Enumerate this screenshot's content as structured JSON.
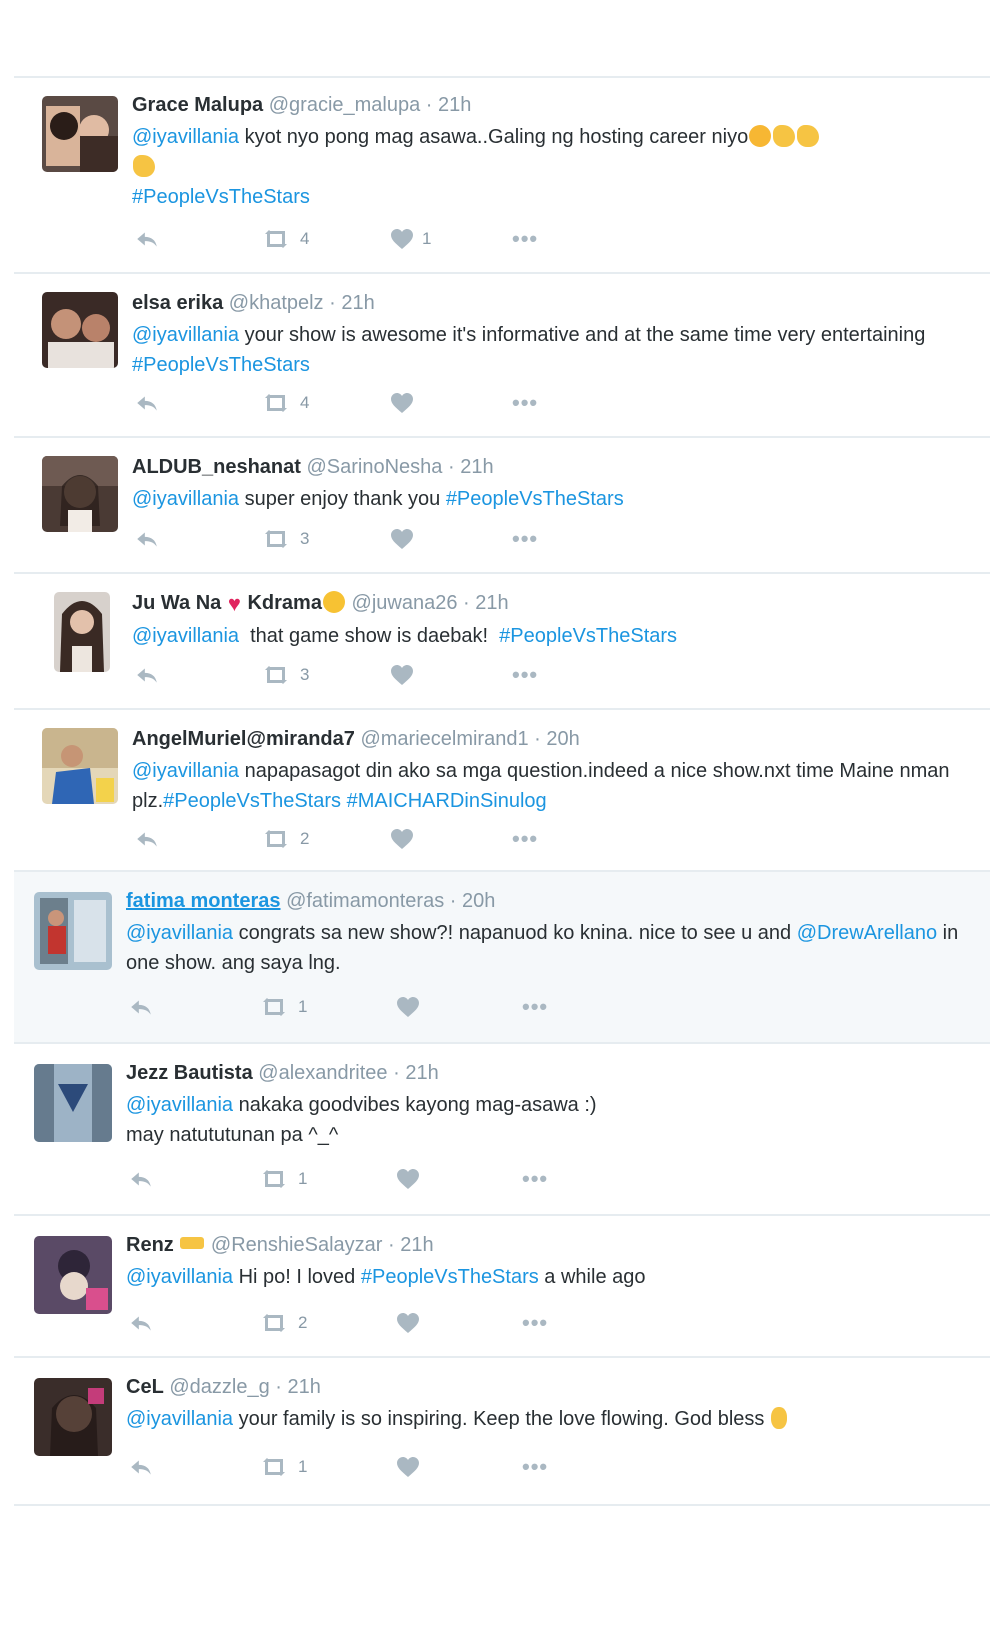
{
  "colors": {
    "link": "#1b95e0",
    "muted": "#8899a6",
    "icon": "#aab8c2",
    "divider": "#e6ecf0",
    "highlight_bg": "#f5f8fa"
  },
  "icons": {
    "reply": "reply-icon",
    "retweet": "retweet-icon",
    "like": "heart-icon",
    "more": "more-icon"
  },
  "tweets": [
    {
      "name": "Grace Malupa",
      "handle": "@gracie_malupa",
      "time": "21h",
      "mention": "@iyavillania",
      "t1": " kyot nyo pong mag asawa..Galing ng hosting career niyo",
      "hashtag": "#PeopleVsTheStars",
      "retweets": "4",
      "likes": "1"
    },
    {
      "name": "elsa erika",
      "handle": "@khatpelz",
      "time": "21h",
      "mention": "@iyavillania",
      "t1": " your show is awesome it's informative and at the same time very entertaining ",
      "hashtag": "#PeopleVsTheStars",
      "retweets": "4",
      "likes": ""
    },
    {
      "name": "ALDUB_neshanat",
      "handle": "@SarinoNesha",
      "time": "21h",
      "mention": "@iyavillania",
      "t1": " super enjoy thank you ",
      "hashtag": "#PeopleVsTheStars",
      "retweets": "3",
      "likes": ""
    },
    {
      "name_a": "Ju Wa Na",
      "name_b": "Kdrama",
      "handle": "@juwana26",
      "time": "21h",
      "mention": "@iyavillania",
      "t1": "  that game show is daebak!  ",
      "hashtag": "#PeopleVsTheStars",
      "retweets": "3",
      "likes": ""
    },
    {
      "name": "AngelMuriel@miranda7",
      "handle": "@mariecelmirand1",
      "time": "20h",
      "mention": "@iyavillania",
      "t1": " napapasagot din ako sa mga question.indeed a nice show.nxt time Maine nman plz.",
      "hashtag": "#PeopleVsTheStars",
      "hashtag2": "#MAICHARDinSinulog",
      "retweets": "2",
      "likes": ""
    },
    {
      "name": "fatima monteras",
      "handle": "@fatimamonteras",
      "time": "20h",
      "mention": "@iyavillania",
      "t1": " congrats sa new show?! napanuod ko knina. nice to see u and ",
      "mention2": "@DrewArellano",
      "t2": " in one show. ang saya lng.",
      "retweets": "1",
      "likes": ""
    },
    {
      "name": "Jezz Bautista",
      "handle": "@alexandritee",
      "time": "21h",
      "mention": "@iyavillania",
      "t1": " nakaka goodvibes kayong mag-asawa :)",
      "t2": "may natututunan pa ^_^",
      "retweets": "1",
      "likes": ""
    },
    {
      "name": "Renz",
      "handle": "@RenshieSalayzar",
      "time": "21h",
      "mention": "@iyavillania",
      "t1": " Hi po! I loved ",
      "hashtag": "#PeopleVsTheStars",
      "t2": " a while ago",
      "retweets": "2",
      "likes": ""
    },
    {
      "name": "CeL",
      "handle": "@dazzle_g",
      "time": "21h",
      "mention": "@iyavillania",
      "t1": " your family is so inspiring. Keep the love flowing. God bless ",
      "retweets": "1",
      "likes": ""
    }
  ]
}
